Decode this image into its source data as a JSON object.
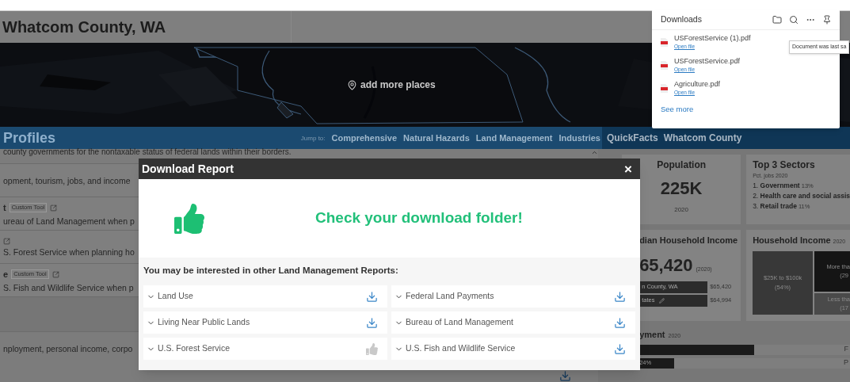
{
  "header": {
    "title": "Whatcom County, WA"
  },
  "map": {
    "button": "add more places"
  },
  "profiles": {
    "title": "Profiles",
    "jump_label": "Jump to:",
    "jump_links": [
      "Comprehensive",
      "Natural Hazards",
      "Land Management",
      "Industries"
    ],
    "intro": "county governments for the nontaxable status of federal lands within their borders.",
    "rows": [
      {
        "text": "opment, tourism, jobs, and income",
        "external_link": false
      },
      {
        "title": "t",
        "badge": "Custom Tool",
        "text": "ureau of Land Management when p",
        "external_link": true
      },
      {
        "text": "S. Forest Service when planning ho",
        "external_link": true
      },
      {
        "title": "e",
        "badge": "Custom Tool",
        "text": "S. Fish and Wildlife Service when p",
        "external_link": true
      }
    ],
    "last_row": "nployment, personal income, corpo"
  },
  "quickfacts": {
    "brand": "QuickFacts",
    "county": "Whatcom County",
    "population": {
      "title": "Population",
      "value": "225K",
      "year": "2020"
    },
    "sectors": {
      "title": "Top 3 Sectors",
      "subtitle": "Pct. jobs 2020",
      "items": [
        {
          "rank": "1.",
          "name": "Government",
          "share": "13%"
        },
        {
          "rank": "2.",
          "name": "Health care and social assis"
        },
        {
          "rank": "3.",
          "name": "Retail trade",
          "share": "11%"
        }
      ]
    },
    "median_income": {
      "title": "dian Household Income",
      "value": "65,420",
      "year": "(2020)",
      "bars": [
        {
          "label": "n County, WA",
          "value": "$65,420",
          "edit": false
        },
        {
          "label": "tates",
          "value": "$64,994",
          "edit": true
        }
      ]
    },
    "household_income": {
      "title": "Household Income",
      "year": "2020",
      "cells": [
        {
          "label": "$25K to $100k",
          "share": "(54%)"
        },
        {
          "label": "More tha",
          "share": "(29"
        },
        {
          "label": "Less tha",
          "share": "(17"
        }
      ]
    },
    "employment": {
      "title": "yment",
      "year": "2020",
      "bars": [
        {
          "label": "F",
          "level": 0.55
        },
        {
          "label": "P",
          "level": 0.17,
          "value": "24%"
        }
      ]
    }
  },
  "modal": {
    "title": "Download Report",
    "close": "×",
    "message": "Check your download folder!",
    "related_title": "You may be interested in other Land Management Reports:",
    "reports": [
      {
        "name": "Land Use",
        "kind": "download"
      },
      {
        "name": "Federal Land Payments",
        "kind": "download"
      },
      {
        "name": "Living Near Public Lands",
        "kind": "download"
      },
      {
        "name": "Bureau of Land Management",
        "kind": "download"
      },
      {
        "name": "U.S. Forest Service",
        "kind": "done"
      },
      {
        "name": "U.S. Fish and Wildlife Service",
        "kind": "download"
      }
    ]
  },
  "downloads": {
    "title": "Downloads",
    "items": [
      {
        "name": "USForestService (1).pdf",
        "action": "Open file"
      },
      {
        "name": "USForestService.pdf",
        "action": "Open file"
      },
      {
        "name": "Agriculture.pdf",
        "action": "Open file"
      }
    ],
    "see_more": "See more",
    "tooltip": "Document was last sa"
  }
}
